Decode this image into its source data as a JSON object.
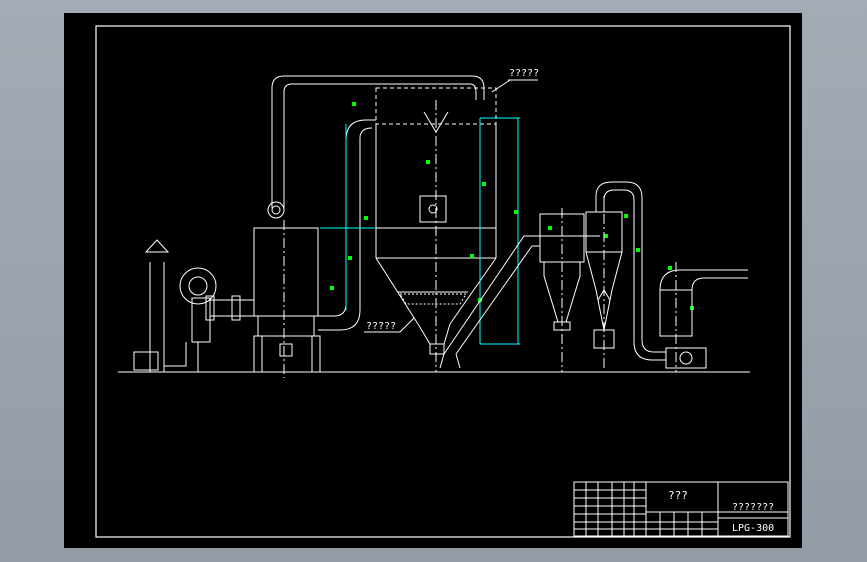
{
  "drawing": {
    "callouts": {
      "top_right": "?????",
      "bottom_left": "?????"
    },
    "title_block": {
      "name_cell": "???",
      "company_cell": "???????",
      "drawing_number": "LPG-300"
    },
    "colors": {
      "background": "#000000",
      "linework": "#ffffff",
      "dimension": "#00ffff",
      "marker": "#00ff00"
    }
  }
}
